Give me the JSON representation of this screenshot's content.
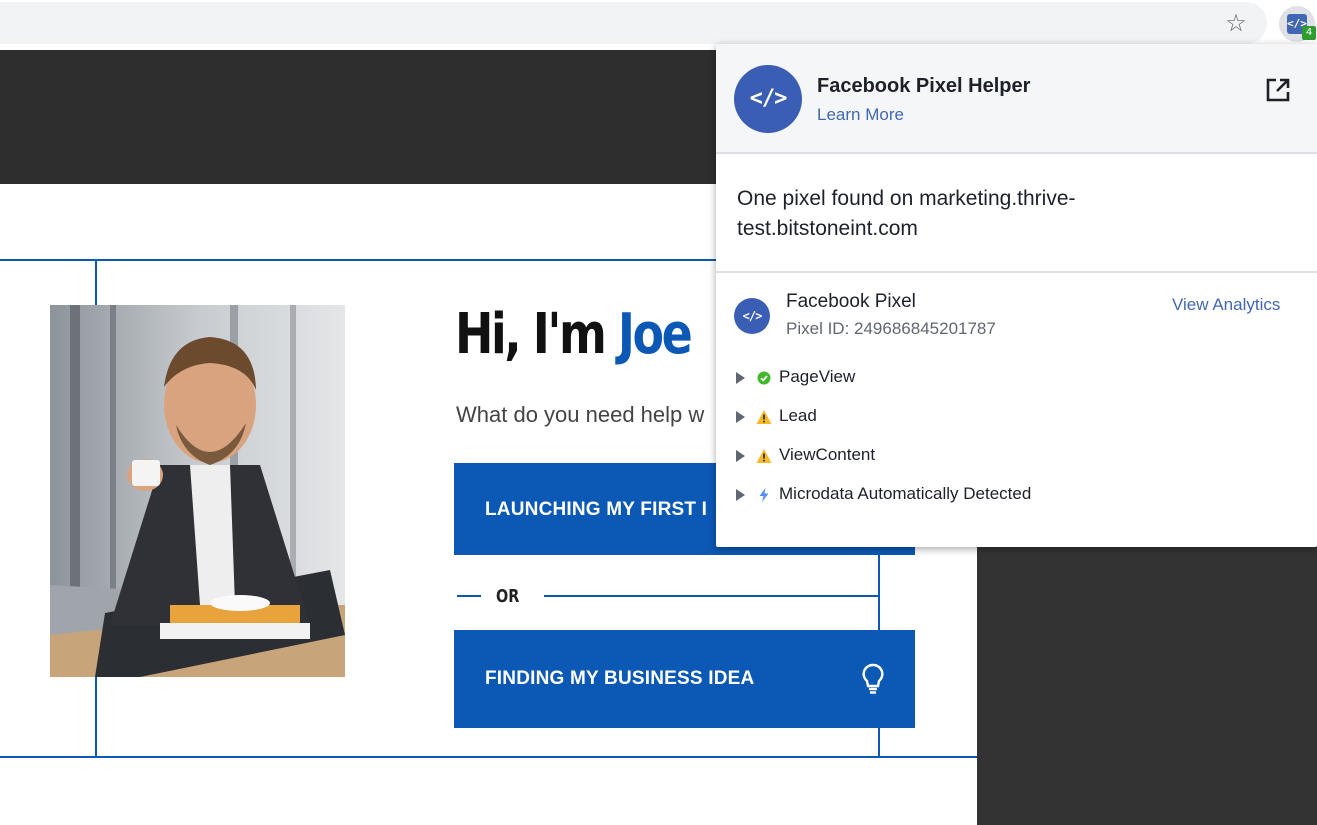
{
  "browser": {
    "star_icon": "star-icon",
    "extension_icon_text": "</>",
    "extension_badge": "4"
  },
  "page": {
    "hero_greeting": "Hi, I'm ",
    "hero_name": "Joe",
    "hero_subtitle": "What do you need help w",
    "cta_1": "LAUNCHING MY FIRST I",
    "or_text": "OR",
    "cta_2": "FINDING MY BUSINESS IDEA",
    "accent_color": "#0b58b5"
  },
  "popup": {
    "logo_text": "</>",
    "title": "Facebook Pixel Helper",
    "learn_more": "Learn More",
    "found_text": "One pixel found on marketing.thrive-test.bitstoneint.com",
    "pixel": {
      "icon_text": "</>",
      "name": "Facebook Pixel",
      "id_text": "Pixel ID: 249686845201787",
      "view_analytics": "View Analytics"
    },
    "events": [
      {
        "label": "PageView",
        "status": "success",
        "status_color": "#42b72a"
      },
      {
        "label": "Lead",
        "status": "warning",
        "status_color": "#f7b928"
      },
      {
        "label": "ViewContent",
        "status": "warning",
        "status_color": "#f7b928"
      },
      {
        "label": "Microdata Automatically Detected",
        "status": "info",
        "status_color": "#4e8ef7"
      }
    ],
    "brand_color": "#4267b2"
  }
}
